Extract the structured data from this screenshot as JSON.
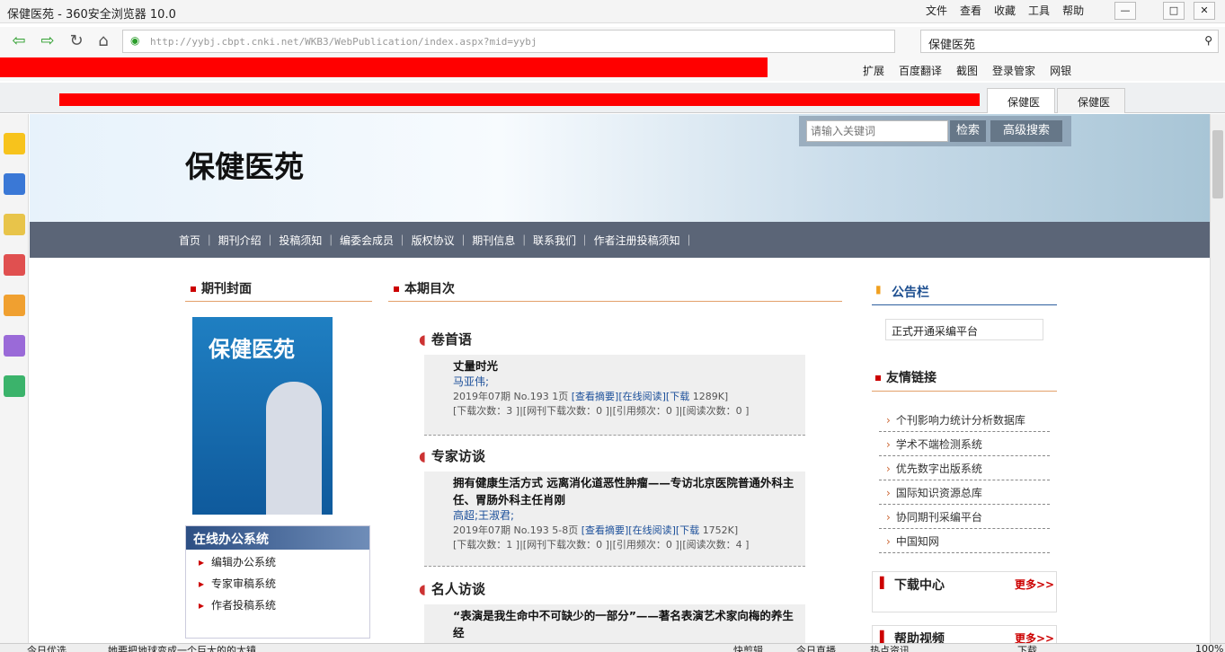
{
  "window": {
    "title": "保健医苑 - 360安全浏览器 10.0",
    "menus": [
      "文件",
      "查看",
      "收藏",
      "工具",
      "帮助"
    ]
  },
  "address": {
    "url": "http://yybj.cbpt.cnki.net/WKB3/WebPublication/index.aspx?mid=yybj",
    "search": "保健医苑"
  },
  "toolbar": {
    "items": [
      "扩展",
      "百度翻译",
      "截图",
      "登录管家",
      "网银"
    ]
  },
  "tabs": [
    {
      "label": "保健医"
    },
    {
      "label": "保健医"
    }
  ],
  "site": {
    "title": "保健医苑",
    "search_placeholder": "请输入关键词",
    "search_btn": "检索",
    "adv_btn": "高级搜索",
    "nav": [
      "首页",
      "期刊介绍",
      "投稿须知",
      "编委会成员",
      "版权协议",
      "期刊信息",
      "联系我们",
      "作者注册投稿须知"
    ],
    "cover_heading": "期刊封面",
    "cover_title": "保健医苑",
    "office": {
      "title": "在线办公系统",
      "items": [
        "编辑办公系统",
        "专家审稿系统",
        "作者投稿系统"
      ]
    },
    "toc_heading": "本期目次",
    "sections": [
      {
        "name": "卷首语",
        "article": {
          "title": "丈量时光",
          "authors": "马亚伟;",
          "meta": "2019年07期 No.193 1页",
          "links": "[查看摘要][在线阅读][下载",
          "size": "1289K]",
          "stats": "[下载次数：3 ]|[网刊下载次数：0 ]|[引用频次：0 ]|[阅读次数：0 ]"
        }
      },
      {
        "name": "专家访谈",
        "article": {
          "title": "拥有健康生活方式 远离消化道恶性肿瘤——专访北京医院普通外科主任、胃肠外科主任肖刚",
          "authors": "高超;王淑君;",
          "meta": "2019年07期 No.193 5-8页",
          "links": "[查看摘要][在线阅读][下载",
          "size": "1752K]",
          "stats": "[下载次数：1 ]|[网刊下载次数：0 ]|[引用频次：0 ]|[阅读次数：4 ]"
        }
      },
      {
        "name": "名人访谈",
        "article": {
          "title": "“表演是我生命中不可缺少的一部分”——著名表演艺术家向梅的养生经"
        }
      }
    ],
    "notice": {
      "title": "公告栏",
      "item": "正式开通采编平台"
    },
    "links": {
      "title": "友情链接",
      "items": [
        "个刊影响力统计分析数据库",
        "学术不端检测系统",
        "优先数字出版系统",
        "国际知识资源总库",
        "协同期刊采编平台",
        "中国知网"
      ]
    },
    "download": {
      "title": "下载中心",
      "more": "更多>>"
    },
    "help": {
      "title": "帮助视频",
      "more": "更多>>"
    }
  },
  "status": {
    "left": "今日优选",
    "news": "她要把地球变成一个巨大的的太镜",
    "items": [
      "快剪辑",
      "今日直播",
      "热点资讯",
      "下载",
      "100%"
    ]
  }
}
